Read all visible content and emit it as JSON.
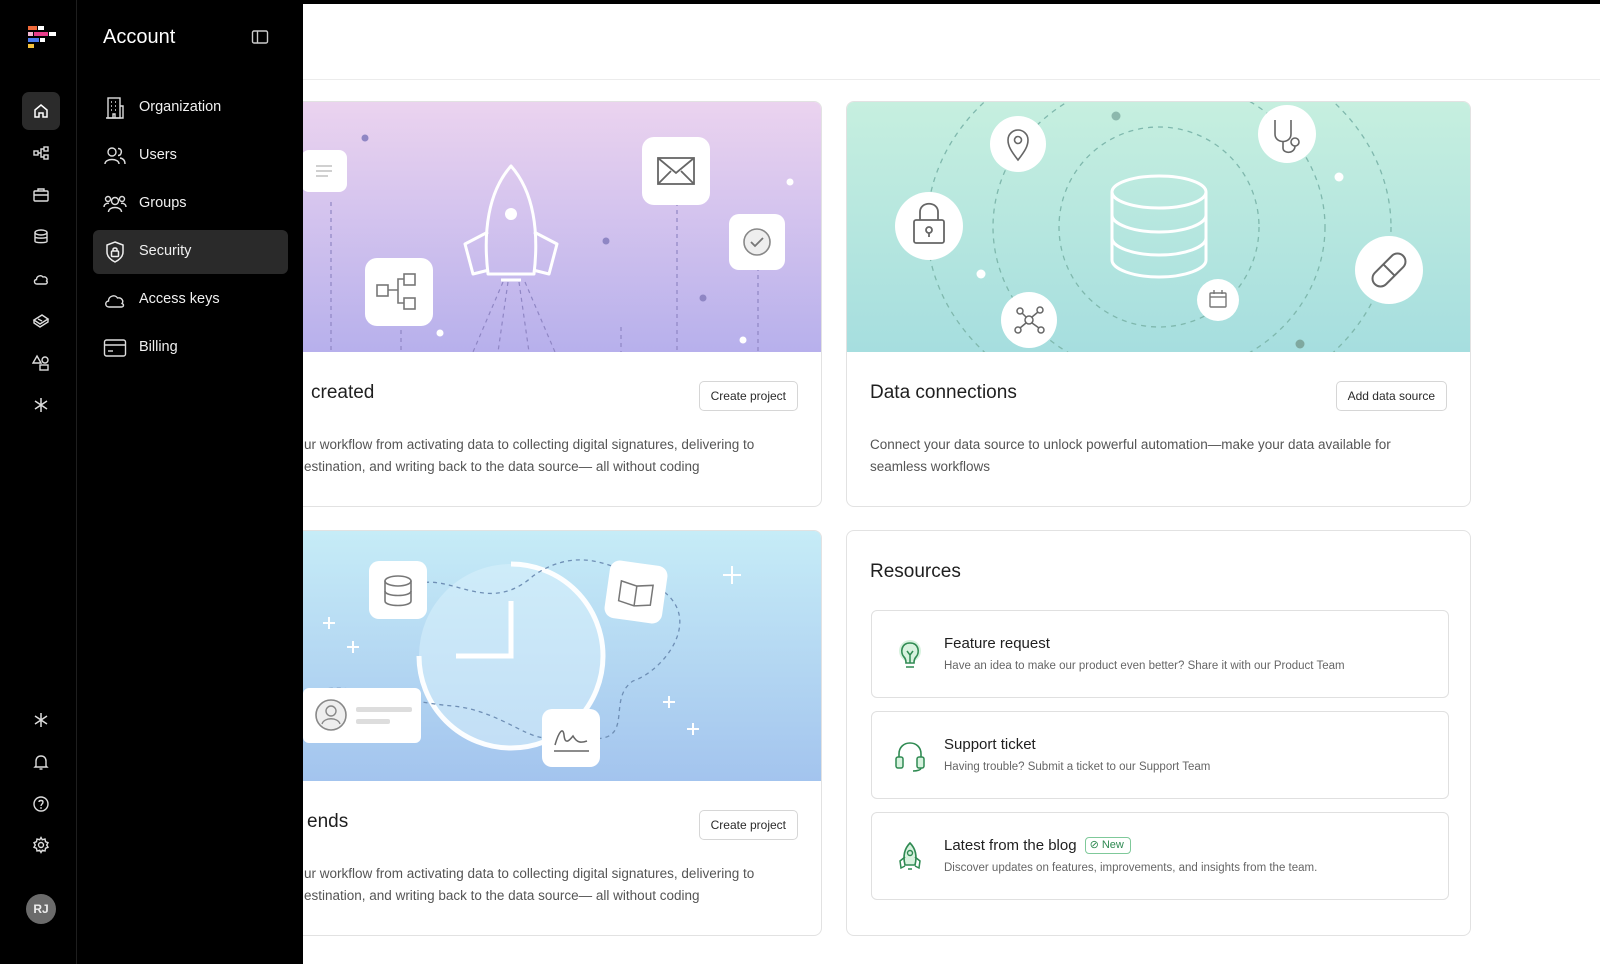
{
  "panel": {
    "title": "Account",
    "items": [
      {
        "label": "Organization",
        "icon": "building-icon"
      },
      {
        "label": "Users",
        "icon": "users-icon"
      },
      {
        "label": "Groups",
        "icon": "groups-icon"
      },
      {
        "label": "Security",
        "icon": "shield-lock-icon",
        "active": true
      },
      {
        "label": "Access keys",
        "icon": "cloud-icon"
      },
      {
        "label": "Billing",
        "icon": "credit-card-icon"
      }
    ]
  },
  "rail": {
    "top_icons": [
      "home-icon",
      "workflow-icon",
      "briefcase-icon",
      "database-icon",
      "cloud-icon",
      "ticket-icon",
      "shapes-icon",
      "asterisk-icon"
    ],
    "bottom_icons": [
      "asterisk-icon",
      "bell-icon",
      "help-icon",
      "gear-icon"
    ],
    "avatar_initials": "RJ"
  },
  "cards": {
    "projects": {
      "title": "created",
      "button": "Create project",
      "desc_line1": "ur workflow from activating data to collecting digital signatures, delivering to",
      "desc_line2": "estination, and writing back to the data source— all without coding"
    },
    "connections": {
      "title": "Data connections",
      "button": "Add data source",
      "desc_line1": "Connect your data source to unlock powerful automation—make your data available for",
      "desc_line2": "seamless workflows"
    },
    "trends": {
      "title": "ends",
      "button": "Create project",
      "desc_line1": "ur workflow from activating data to collecting digital signatures, delivering to",
      "desc_line2": "estination, and writing back to the data source— all without coding"
    }
  },
  "resources": {
    "title": "Resources",
    "items": [
      {
        "title": "Feature request",
        "desc": "Have an idea to make our product even better? Share it with our Product Team",
        "icon": "lightbulb-icon"
      },
      {
        "title": "Support ticket",
        "desc": "Having trouble? Submit a ticket to our Support Team",
        "icon": "headset-icon"
      },
      {
        "title": "Latest from the blog",
        "badge": "New",
        "desc": "Discover updates on features, improvements, and insights from the team.",
        "icon": "rocket-icon"
      }
    ]
  },
  "colors": {
    "accent_green": "#2f8a52",
    "banner_purple_top": "#ecd3ef",
    "banner_purple_bottom": "#b8b1ec",
    "banner_mint_top": "#c8f0e0",
    "banner_mint_bottom": "#a7dfe0",
    "banner_blue_top": "#c5ecf7",
    "banner_blue_bottom": "#a3c5ee"
  }
}
